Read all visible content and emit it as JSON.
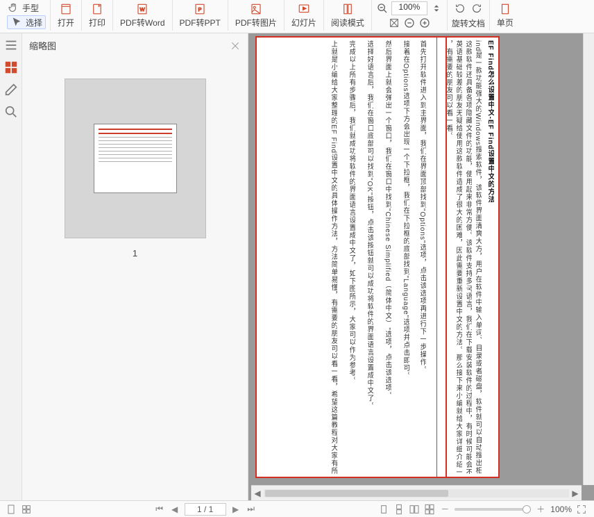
{
  "toolbar": {
    "hand_label": "手型",
    "select_label": "选择",
    "open_label": "打开",
    "print_label": "打印",
    "pdf2word_label": "PDF转Word",
    "pdf2ppt_label": "PDF转PPT",
    "pdf2img_label": "PDF转图片",
    "slideshow_label": "幻灯片",
    "reading_label": "阅读模式",
    "zoom_value": "100%",
    "rotate_label": "旋转文档",
    "single_page_label": "单页"
  },
  "panel": {
    "title": "缩略图",
    "page_number": "1"
  },
  "doc": {
    "title": "EF Find怎么设置中文-EF Find设置中文的方法",
    "lines": [
      "ind是一款功能强大的Windows搜索软件，该软件界面清爽大方，用户在软件中输入单词、目录或者磁盘，软件就可以自动搜出相",
      "这款软件还具备各项隐藏文件的功能，使用起来非常方便。该软件支持多국语言，我们在下载安装软件的过程中，有时候可能会不小心将界",
      "英语基础较差的朋友无疑给使用这款软件造成了很大的困难，因此需要重新设置中文的方法。那么接下来小编就给大家详细介绍一下EF Fin",
      "，有需要的朋友可以看一看。",
      "首先打开软件进入到主界面，我们在界面顶部找到\"Options\"选项，点击该选项再进行下一步操作。",
      "接着在Options选项下方会出现一个下拉框，我们在下拉框的底部找到\"Language\"选项并点击即可。",
      "然后界面上就会弹出一个窗口，我们在窗口中找到\"Chinese Simplified（简体中文）\"选项，点击该选项。",
      "选择好语言后，我们在窗口底部可以找到\"OK\"按钮，点击该按钮就可以成功将软件的界面语言设置成中文了。",
      "完成以上所有步骤后，我们就成功将软件的界面语言设置成中文了，如下图所示，大家可以作为参考。",
      "上就是小编给大家整理的EF Find设置中文的具体操作方法，方法简单易懂，有需要的朋友可以看一看，希望这篇教程对大家有所帮助。"
    ]
  },
  "status": {
    "page": "1 / 1",
    "zoom": "100%"
  }
}
